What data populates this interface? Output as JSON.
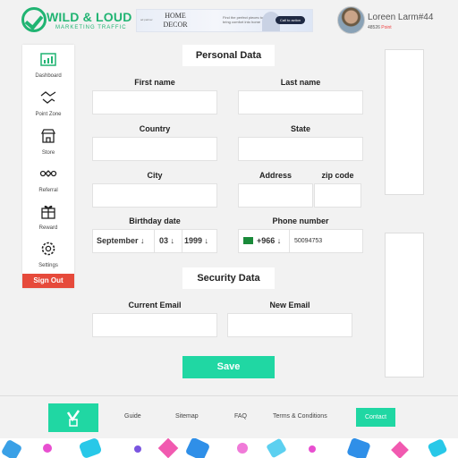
{
  "brand": {
    "name": "WILD & LOUD",
    "tagline": "MARKETING TRAFFIC"
  },
  "ad": {
    "small_text": "ad  partner",
    "brand": "HOME DECOR",
    "text": "Find the perfect pieces to bring comfort into home",
    "cta": "Call to action"
  },
  "user": {
    "name": "Loreen Larm#44",
    "points_value": "48526",
    "points_label": "Point"
  },
  "sidebar": {
    "items": [
      {
        "label": "Dashboard",
        "icon": "dashboard-icon"
      },
      {
        "label": "Point Zone",
        "icon": "handshake-icon"
      },
      {
        "label": "Store",
        "icon": "store-icon"
      },
      {
        "label": "Referral",
        "icon": "referral-icon"
      },
      {
        "label": "Reward",
        "icon": "reward-icon"
      },
      {
        "label": "Settings",
        "icon": "gear-icon"
      }
    ],
    "signout": "Sign Out"
  },
  "personal": {
    "title": "Personal Data",
    "first_name_label": "First name",
    "last_name_label": "Last name",
    "country_label": "Country",
    "state_label": "State",
    "city_label": "City",
    "address_label": "Address",
    "zip_label": "zip code",
    "birthday_label": "Birthday date",
    "birthday_month": "September",
    "birthday_day": "03",
    "birthday_year": "1999",
    "phone_label": "Phone number",
    "phone_code": "+966",
    "phone_number": "50094753"
  },
  "security": {
    "title": "Security Data",
    "current_email_label": "Current Email",
    "new_email_label": "New Email"
  },
  "save_label": "Save",
  "footer": {
    "links": [
      "Guide",
      "Sitemap",
      "FAQ",
      "Terms & Conditions"
    ],
    "contact": "Contact"
  },
  "colors": {
    "accent": "#20d7a3",
    "brand_green": "#20b472",
    "signout": "#e64a3b"
  }
}
